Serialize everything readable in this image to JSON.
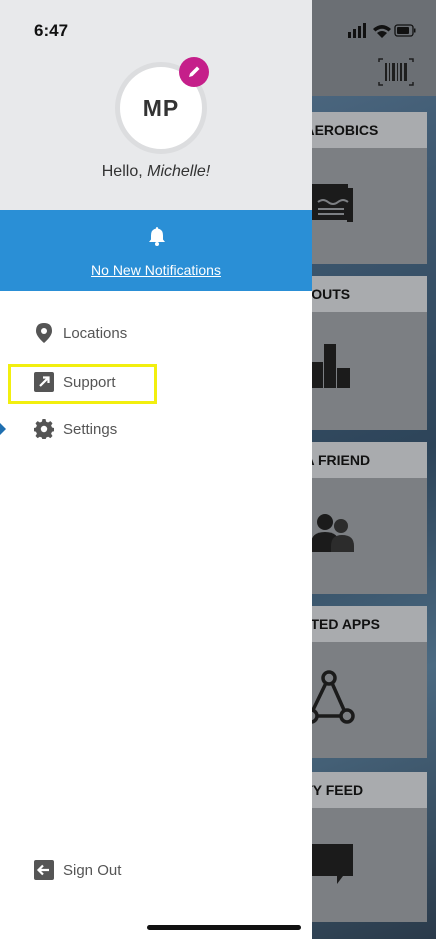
{
  "status_bar": {
    "time": "6:47"
  },
  "profile": {
    "initials": "MP",
    "greeting_prefix": "Hello,",
    "greeting_name": "Michelle!"
  },
  "notifications": {
    "label": "No New Notifications"
  },
  "menu": {
    "items": [
      {
        "label": "Locations",
        "icon": "location-pin-icon"
      },
      {
        "label": "Support",
        "icon": "external-link-icon"
      },
      {
        "label": "Settings",
        "icon": "gear-icon"
      }
    ],
    "sign_out": {
      "label": "Sign Out",
      "icon": "sign-out-icon"
    }
  },
  "background_cards": [
    {
      "title": "R AEROBICS",
      "icon": "swim-log-icon"
    },
    {
      "title": "RKOUTS",
      "icon": "bar-chart-icon"
    },
    {
      "title": "R A FRIEND",
      "icon": "people-icon"
    },
    {
      "title": "ECTED APPS",
      "icon": "connected-nodes-icon"
    },
    {
      "title": "VITY FEED",
      "icon": "chat-bubble-icon"
    }
  ],
  "colors": {
    "notification_bar": "#2a8fd6",
    "edit_badge": "#c51f8a",
    "highlight": "#f2ef0f"
  }
}
